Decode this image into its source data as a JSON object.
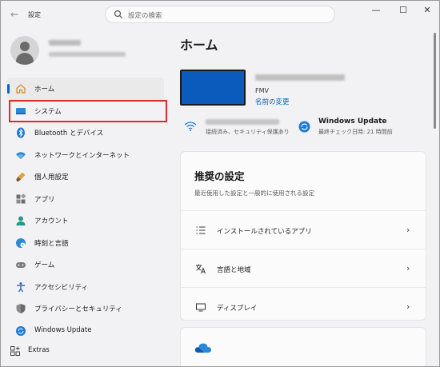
{
  "app": {
    "title": "設定",
    "back_icon": "back-arrow-icon"
  },
  "search": {
    "placeholder": "設定の検索"
  },
  "window_controls": {
    "minimize": "—",
    "maximize": "☐",
    "close": "✕"
  },
  "sidebar": {
    "items": [
      {
        "label": "ホーム",
        "icon": "home-icon",
        "active": true
      },
      {
        "label": "システム",
        "icon": "monitor-icon"
      },
      {
        "label": "Bluetooth とデバイス",
        "icon": "bluetooth-icon"
      },
      {
        "label": "ネットワークとインターネット",
        "icon": "wifi-icon"
      },
      {
        "label": "個人用設定",
        "icon": "brush-icon"
      },
      {
        "label": "アプリ",
        "icon": "apps-icon"
      },
      {
        "label": "アカウント",
        "icon": "account-icon"
      },
      {
        "label": "時刻と言語",
        "icon": "globe-clock-icon"
      },
      {
        "label": "ゲーム",
        "icon": "gamepad-icon"
      },
      {
        "label": "アクセシビリティ",
        "icon": "accessibility-icon"
      },
      {
        "label": "プライバシーとセキュリティ",
        "icon": "shield-icon"
      },
      {
        "label": "Windows Update",
        "icon": "update-icon"
      }
    ],
    "extras": {
      "label": "Extras",
      "icon": "grid-plus-icon"
    }
  },
  "main": {
    "title": "ホーム",
    "device": {
      "model": "FMV",
      "rename_link": "名前の変更"
    },
    "network_status": {
      "text": "接続済み、セキュリティ保護あり"
    },
    "windows_update": {
      "title": "Windows Update",
      "status": "最終チェック日時: 21 時間前"
    },
    "recommended": {
      "title": "推奨の設定",
      "subtitle": "最近使用した設定と一般的に使用される設定",
      "rows": [
        {
          "label": "インストールされているアプリ",
          "icon": "list-icon"
        },
        {
          "label": "言語と地域",
          "icon": "language-icon"
        },
        {
          "label": "ディスプレイ",
          "icon": "display-icon"
        }
      ]
    }
  },
  "colors": {
    "accent": "#0067c0",
    "highlight": "#e0282e",
    "device": "#0b5bbd"
  }
}
